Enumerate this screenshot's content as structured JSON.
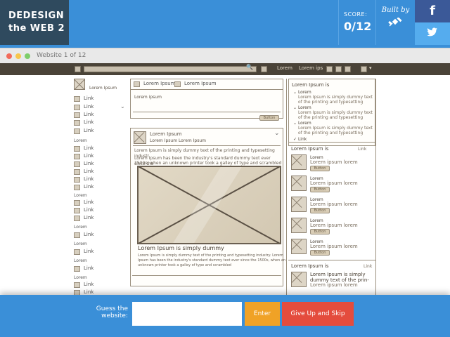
{
  "header": {
    "logo_line1": "DEDESIGN",
    "logo_line2": "the WEB 2",
    "score_label": "SCORE:",
    "score_value": "0/12",
    "built_by": "Built by",
    "built_by_icon": "satellite-icon",
    "facebook_glyph": "f",
    "twitter_glyph": "🐦"
  },
  "window": {
    "title": "Website 1 of 12"
  },
  "wireframe": {
    "topbar": {
      "links": [
        "Lorem",
        "Lorem ips"
      ]
    },
    "left": {
      "profile_label": "Lorem Ipsum",
      "group_label": "Lorem",
      "link_label": "Link"
    },
    "middle": {
      "tab1": "Lorem Ipsum",
      "tab2": "Lorem Ipsum",
      "panel1_text": "Lorem ipsum",
      "button_label": "Button",
      "post_title": "Lorem Ipsum",
      "post_subtitle": "Lorem Ipsum Lorem Ipsum",
      "post_line1": "Lorem Ipsum is simply dummy text of the printing and typesetting industr",
      "post_line2": "Lorem Ipsum has been the industry's standard dummy text ever since the",
      "post_line3": "1500s, when an unknown printer took a galley of type and scrambled",
      "caption_title": "Lorem Ipsum is simply dummy",
      "caption_line1": "Lorem Ipsum is simply dummy text of the printing and typesetting industry. Lorem",
      "caption_line2": "Ipsum has been the industry's standard dummy text ever since the 1500s, when an",
      "caption_line3": "unknown printer took a galley of type and scrambled"
    },
    "right": {
      "section1_title": "Lorem Ipsum is",
      "item_title": "Lorem",
      "item_line1": "Lorem Ipsum is simply dummy text",
      "item_line2": "of the printing and typesetting",
      "more_link": "Link",
      "section2_title": "Lorem Ipsum is",
      "section2_link": "Link",
      "card_title": "Lorem",
      "card_text": "Lorem ipsum lorem",
      "card_button": "Button",
      "section3_title": "Lorem Ipsum is",
      "section3_link": "Link",
      "last_title1": "Lorem Ipsum is simply",
      "last_title2": "dummy text of the prin-",
      "last_text": "Lorem ipsum lorem"
    }
  },
  "bottom": {
    "guess_line1": "Guess the",
    "guess_line2": "website:",
    "input_value": "",
    "input_placeholder": "",
    "enter_label": "Enter",
    "skip_label": "Give Up and Skip"
  },
  "colors": {
    "primary": "#3a8fd8",
    "logo_bg": "#2f4a5e",
    "facebook": "#3b5998",
    "twitter": "#55acee",
    "enter": "#f0a226",
    "skip": "#e44c3d"
  }
}
